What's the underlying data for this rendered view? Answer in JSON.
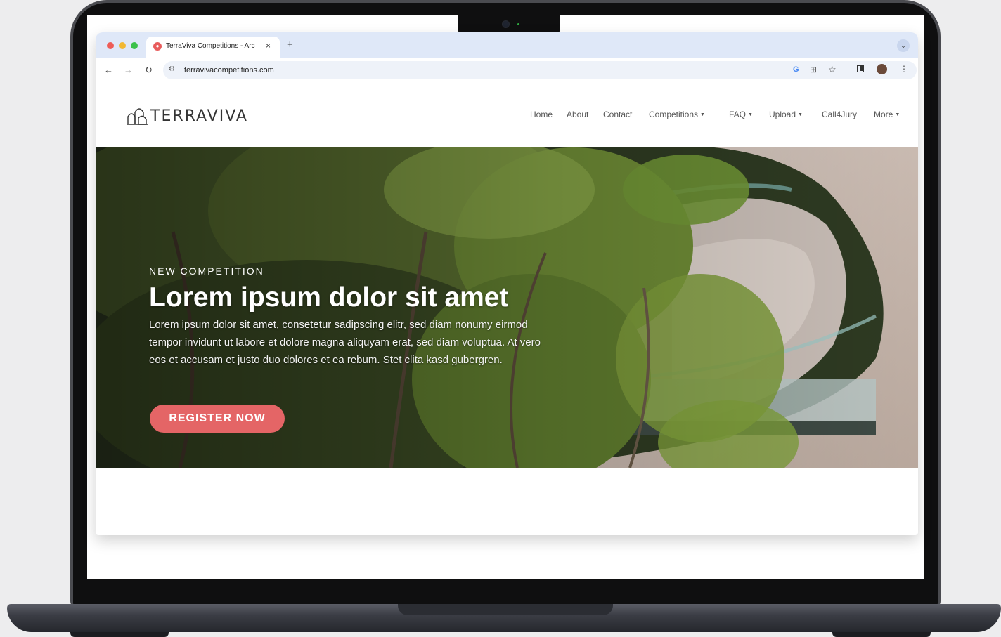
{
  "browser": {
    "tab_title": "TerraViva Competitions - Arc",
    "tab_favicon_icon": "terraviva-pin-icon",
    "url": "terravivacompetitions.com",
    "new_tab_symbol": "+",
    "close_symbol": "×"
  },
  "site": {
    "logo_text": "TERRAVIVA",
    "nav": [
      {
        "label": "Home",
        "dropdown": false
      },
      {
        "label": "About",
        "dropdown": false
      },
      {
        "label": "Contact",
        "dropdown": false
      },
      {
        "label": "Competitions",
        "dropdown": true
      },
      {
        "label": "FAQ",
        "dropdown": true
      },
      {
        "label": "Upload",
        "dropdown": true
      },
      {
        "label": "Call4Jury",
        "dropdown": false
      },
      {
        "label": "More",
        "dropdown": true
      }
    ]
  },
  "hero": {
    "label": "NEW COMPETITION",
    "title": "Lorem ipsum dolor sit amet",
    "text": "Lorem ipsum dolor sit amet, consetetur sadipscing elitr, sed diam nonumy eirmod tempor invidunt ut labore et dolore magna aliquyam erat, sed diam voluptua. At vero eos et accusam et justo duo dolores et ea rebum. Stet clita kasd gubergren.",
    "button_label": "REGISTER NOW"
  },
  "colors": {
    "accent": "#e46566",
    "tab_bar": "#dfe8f8"
  }
}
